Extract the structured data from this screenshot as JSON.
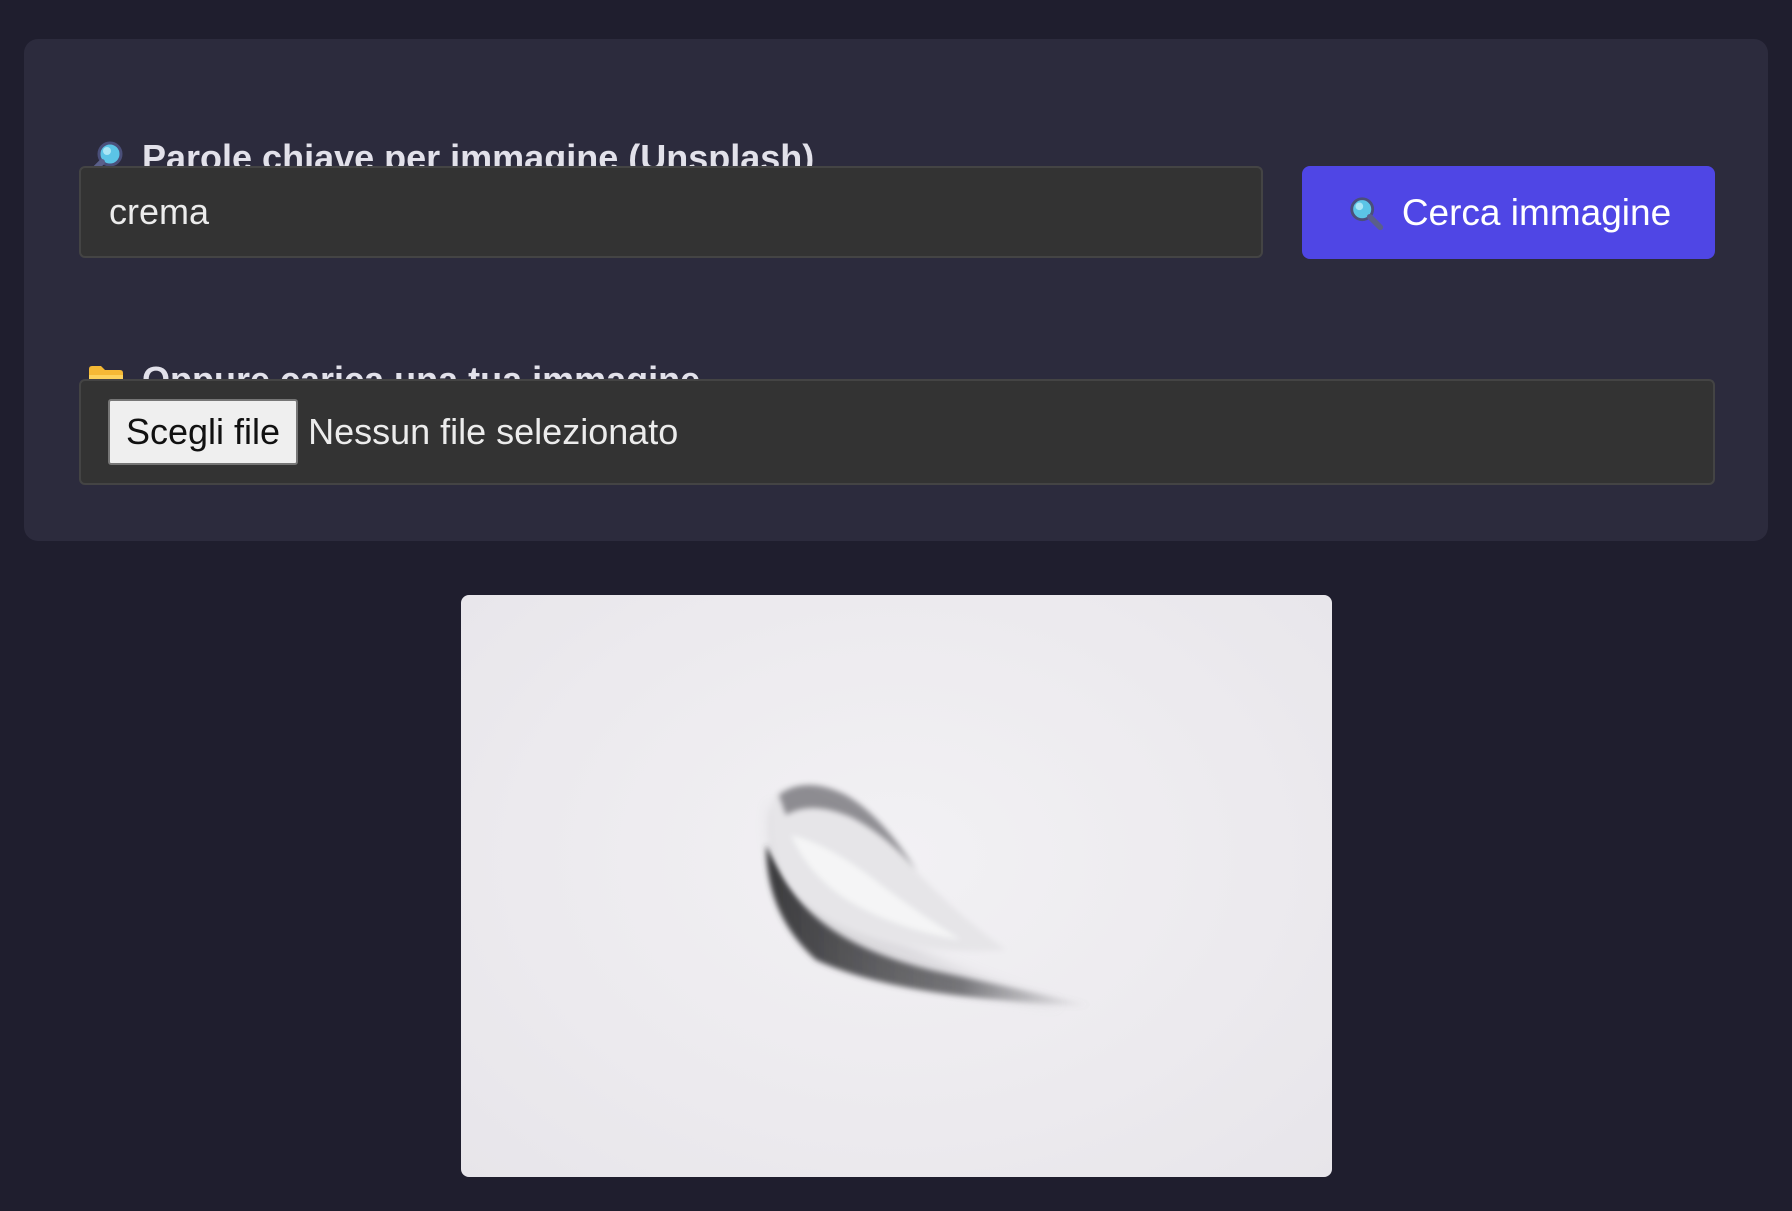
{
  "search": {
    "label": "Parole chiave per immagine (Unsplash)",
    "label_icon": "magnifying-glass-tilted-right-icon",
    "value": "crema",
    "button_label": "Cerca immagine",
    "button_icon": "magnifying-glass-tilted-left-icon"
  },
  "upload": {
    "label": "Oppure carica una tua immagine",
    "label_icon": "folder-icon",
    "choose_label": "Scegli file",
    "status": "Nessun file selezionato"
  },
  "preview": {
    "image": "cream-swatch-photo"
  },
  "colors": {
    "background": "#1f1e2e",
    "panel": "#2c2b3d",
    "input": "#333333",
    "accent": "#4f46e5"
  }
}
